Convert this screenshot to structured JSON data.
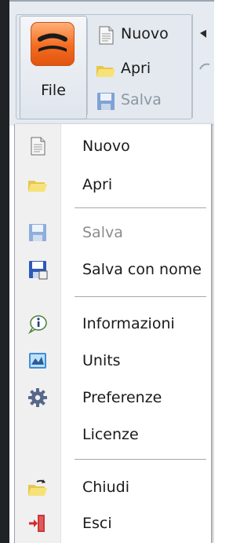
{
  "ribbon": {
    "file_label": "File",
    "items": [
      {
        "label": "Nuovo",
        "icon": "new-document-icon",
        "enabled": true
      },
      {
        "label": "Apri",
        "icon": "folder-icon",
        "enabled": true
      },
      {
        "label": "Salva",
        "icon": "save-icon",
        "enabled": false
      }
    ]
  },
  "menu": {
    "items": [
      {
        "label": "Nuovo",
        "icon": "new-document-icon",
        "enabled": true
      },
      {
        "label": "Apri",
        "icon": "folder-icon",
        "enabled": true
      },
      {
        "label": "Salva",
        "icon": "save-icon",
        "enabled": false
      },
      {
        "label": "Salva con nome",
        "icon": "save-as-icon",
        "enabled": true
      },
      {
        "label": "Informazioni",
        "icon": "info-icon",
        "enabled": true
      },
      {
        "label": "Units",
        "icon": "units-icon",
        "enabled": true
      },
      {
        "label": "Preferenze",
        "icon": "gear-icon",
        "enabled": true
      },
      {
        "label": "Licenze",
        "icon": "",
        "enabled": true
      },
      {
        "label": "Chiudi",
        "icon": "close-folder-icon",
        "enabled": true
      },
      {
        "label": "Esci",
        "icon": "exit-icon",
        "enabled": true
      }
    ]
  },
  "colors": {
    "file_button": "#f46b1f",
    "menu_gutter": "#f0f0f0",
    "disabled_text": "#8c8c8c"
  }
}
